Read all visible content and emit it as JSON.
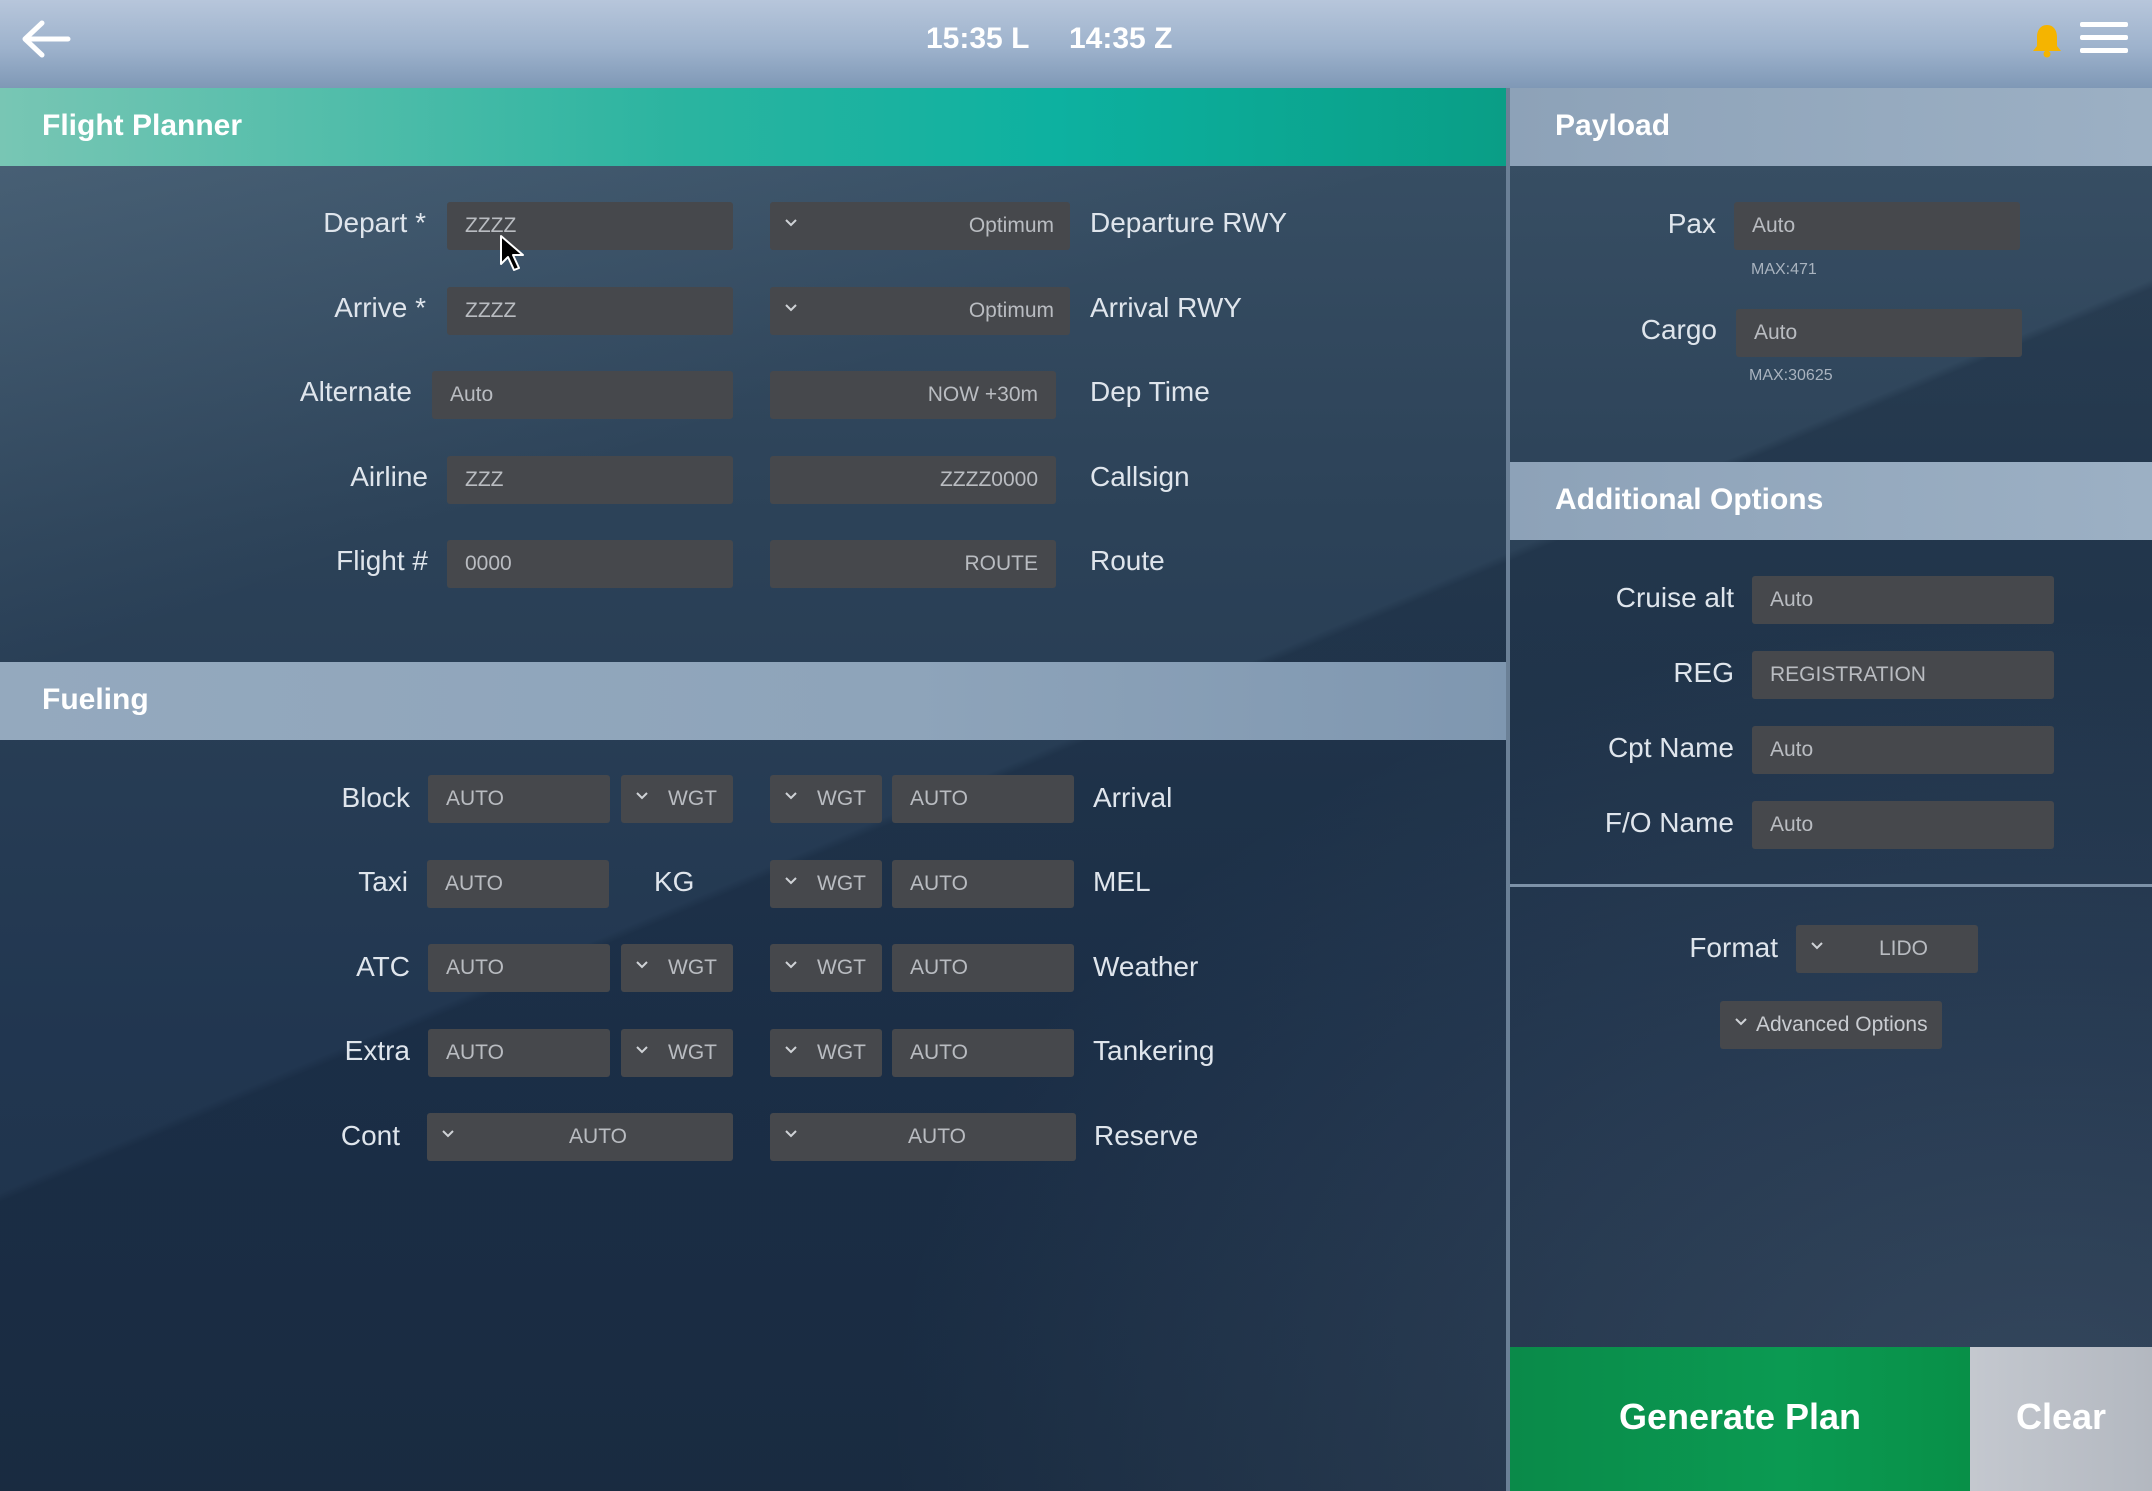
{
  "topbar": {
    "local_time": "15:35 L",
    "zulu_time": "14:35 Z"
  },
  "icons": {
    "back": "back-arrow-icon",
    "notifications": "bell-icon",
    "menu": "hamburger-menu-icon",
    "dropdown": "chevron-down-icon"
  },
  "colors": {
    "planner_header": "#0db1a0",
    "generate_button": "#0b9a52",
    "clear_button": "#b3b8c0",
    "bell": "#f5b400",
    "field_bg": "#46484c"
  },
  "flight_planner": {
    "title": "Flight Planner",
    "depart": {
      "label": "Depart *",
      "value": "ZZZZ"
    },
    "arrive": {
      "label": "Arrive *",
      "value": "ZZZZ"
    },
    "alternate": {
      "label": "Alternate",
      "value": "Auto"
    },
    "airline": {
      "label": "Airline",
      "value": "ZZZ"
    },
    "flight_number": {
      "label": "Flight #",
      "value": "0000"
    },
    "departure_rwy": {
      "label": "Departure RWY",
      "value": "Optimum"
    },
    "arrival_rwy": {
      "label": "Arrival RWY",
      "value": "Optimum"
    },
    "dep_time": {
      "label": "Dep Time",
      "value": "NOW +30m"
    },
    "callsign": {
      "label": "Callsign",
      "value": "ZZZZ0000"
    },
    "route": {
      "label": "Route",
      "value": "ROUTE"
    }
  },
  "fueling": {
    "title": "Fueling",
    "unit": "KG",
    "block": {
      "label": "Block",
      "value": "AUTO",
      "mode": "WGT"
    },
    "taxi": {
      "label": "Taxi",
      "value": "AUTO"
    },
    "atc": {
      "label": "ATC",
      "value": "AUTO",
      "mode": "WGT"
    },
    "extra": {
      "label": "Extra",
      "value": "AUTO",
      "mode": "WGT"
    },
    "cont": {
      "label": "Cont",
      "value": "AUTO"
    },
    "arrival": {
      "label": "Arrival",
      "value": "AUTO",
      "mode": "WGT"
    },
    "mel": {
      "label": "MEL",
      "value": "AUTO",
      "mode": "WGT"
    },
    "weather": {
      "label": "Weather",
      "value": "AUTO",
      "mode": "WGT"
    },
    "tankering": {
      "label": "Tankering",
      "value": "AUTO",
      "mode": "WGT"
    },
    "reserve": {
      "label": "Reserve",
      "value": "AUTO"
    }
  },
  "payload": {
    "title": "Payload",
    "pax": {
      "label": "Pax",
      "value": "Auto",
      "max": "MAX:471"
    },
    "cargo": {
      "label": "Cargo",
      "value": "Auto",
      "max": "MAX:30625"
    }
  },
  "additional_options": {
    "title": "Additional Options",
    "cruise_alt": {
      "label": "Cruise alt",
      "value": "Auto"
    },
    "reg": {
      "label": "REG",
      "value": "REGISTRATION"
    },
    "cpt_name": {
      "label": "Cpt Name",
      "value": "Auto"
    },
    "fo_name": {
      "label": "F/O Name",
      "value": "Auto"
    },
    "format": {
      "label": "Format",
      "value": "LIDO"
    },
    "advanced_options": "Advanced Options"
  },
  "actions": {
    "generate": "Generate Plan",
    "clear": "Clear"
  }
}
